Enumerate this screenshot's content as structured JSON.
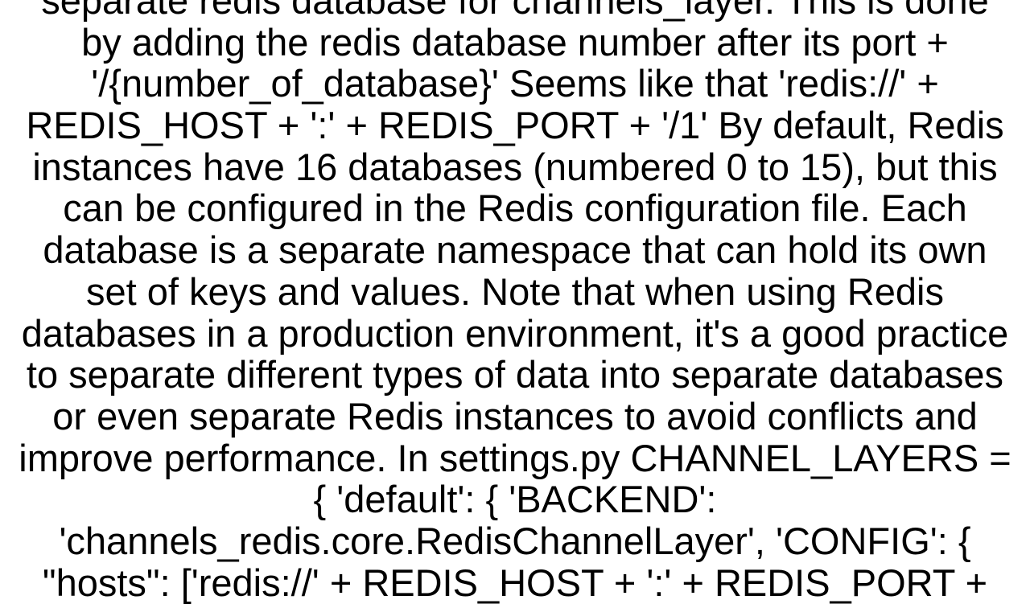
{
  "body_text": "separate redis database for channels_layer. This is done by adding the redis database number after its port + '/{number_of_database}' Seems like that 'redis://' + REDIS_HOST + ':' + REDIS_PORT + '/1' By default, Redis instances have 16 databases (numbered 0 to 15), but this can be configured in the Redis configuration file. Each database is a separate namespace that can hold its own set of keys and values. Note that when using Redis databases in a production environment, it's a good practice to separate different types of data into separate databases or even separate Redis instances to avoid conflicts and improve performance. In settings.py CHANNEL_LAYERS = {     'default': {         'BACKEND': 'channels_redis.core.RedisChannelLayer',         'CONFIG': {             \"hosts\": ['redis://' + REDIS_HOST + ':' + REDIS_PORT +"
}
